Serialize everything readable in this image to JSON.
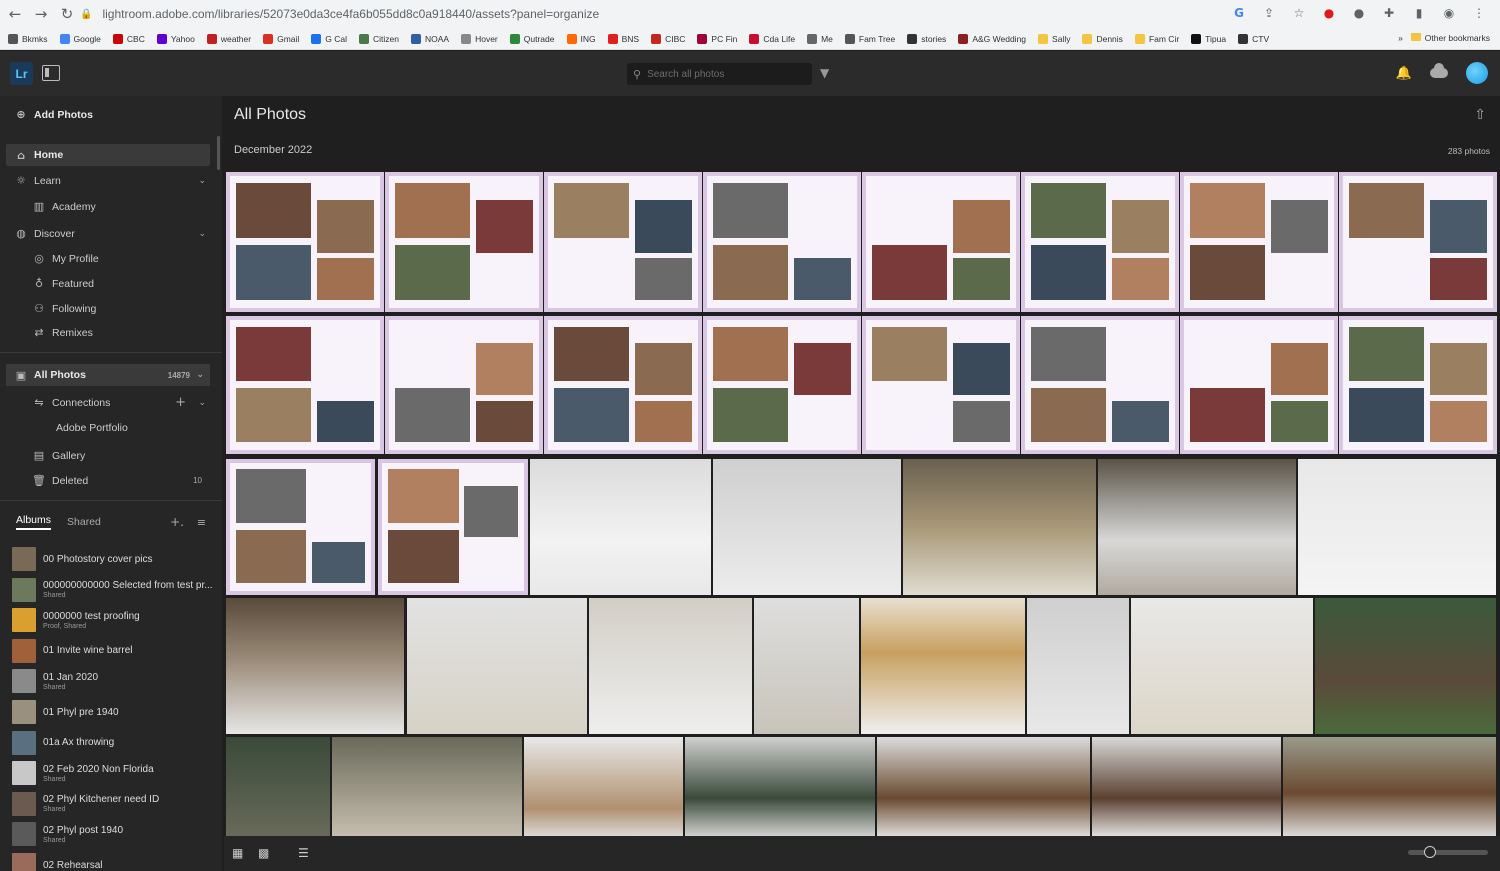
{
  "browser": {
    "url": "lightroom.adobe.com/libraries/52073e0da3ce4fa6b055dd8c0a918440/assets?panel=organize",
    "bookmarks": [
      "Bkmks",
      "Google",
      "CBC",
      "Yahoo",
      "weather",
      "Gmail",
      "G Cal",
      "Citizen",
      "NOAA",
      "Hover",
      "Qutrade",
      "ING",
      "BNS",
      "CIBC",
      "PC Fin",
      "Cda Life",
      "Me",
      "Fam Tree",
      "stories",
      "A&G Wedding",
      "Sally",
      "Dennis",
      "Fam Cir",
      "Tipua",
      "CTV"
    ],
    "other_bookmarks": "Other bookmarks",
    "more": "»"
  },
  "app": {
    "logo": "Lr",
    "search_placeholder": "Search all photos"
  },
  "sidebar": {
    "add_photos": "Add Photos",
    "home": "Home",
    "learn": "Learn",
    "academy": "Academy",
    "discover": "Discover",
    "my_profile": "My Profile",
    "featured": "Featured",
    "following": "Following",
    "remixes": "Remixes",
    "all_photos": "All Photos",
    "all_photos_count": "14879",
    "connections": "Connections",
    "adobe_portfolio": "Adobe Portfolio",
    "gallery": "Gallery",
    "deleted": "Deleted",
    "deleted_count": "10",
    "tab_albums": "Albums",
    "tab_shared": "Shared",
    "albums": [
      {
        "name": "00 Photostory cover pics",
        "sub": "",
        "color": "#7a6a55"
      },
      {
        "name": "000000000000 Selected from test pr...",
        "sub": "Shared",
        "color": "#6b7a5a"
      },
      {
        "name": "0000000 test proofing",
        "sub": "Proof, Shared",
        "color": "#d9a030"
      },
      {
        "name": "01 Invite wine barrel",
        "sub": "",
        "color": "#a0603a"
      },
      {
        "name": "01 Jan 2020",
        "sub": "Shared",
        "color": "#8a8a8a"
      },
      {
        "name": "01 Phyl pre 1940",
        "sub": "",
        "color": "#9a9080"
      },
      {
        "name": "01a Ax throwing",
        "sub": "",
        "color": "#5a7080"
      },
      {
        "name": "02 Feb 2020 Non Florida",
        "sub": "Shared",
        "color": "#c8c8c8"
      },
      {
        "name": "02 Phyl Kitchener need ID",
        "sub": "Shared",
        "color": "#6a5a50"
      },
      {
        "name": "02 Phyl post 1940",
        "sub": "Shared",
        "color": "#5a5a5a"
      },
      {
        "name": "02 Rehearsal",
        "sub": "",
        "color": "#9a6a5a"
      }
    ]
  },
  "main": {
    "title": "All Photos",
    "month": "December 2022",
    "photo_count": "283 photos"
  },
  "colors": {
    "accent": "#5ec3f5",
    "page_border": "#d9c6e2"
  }
}
